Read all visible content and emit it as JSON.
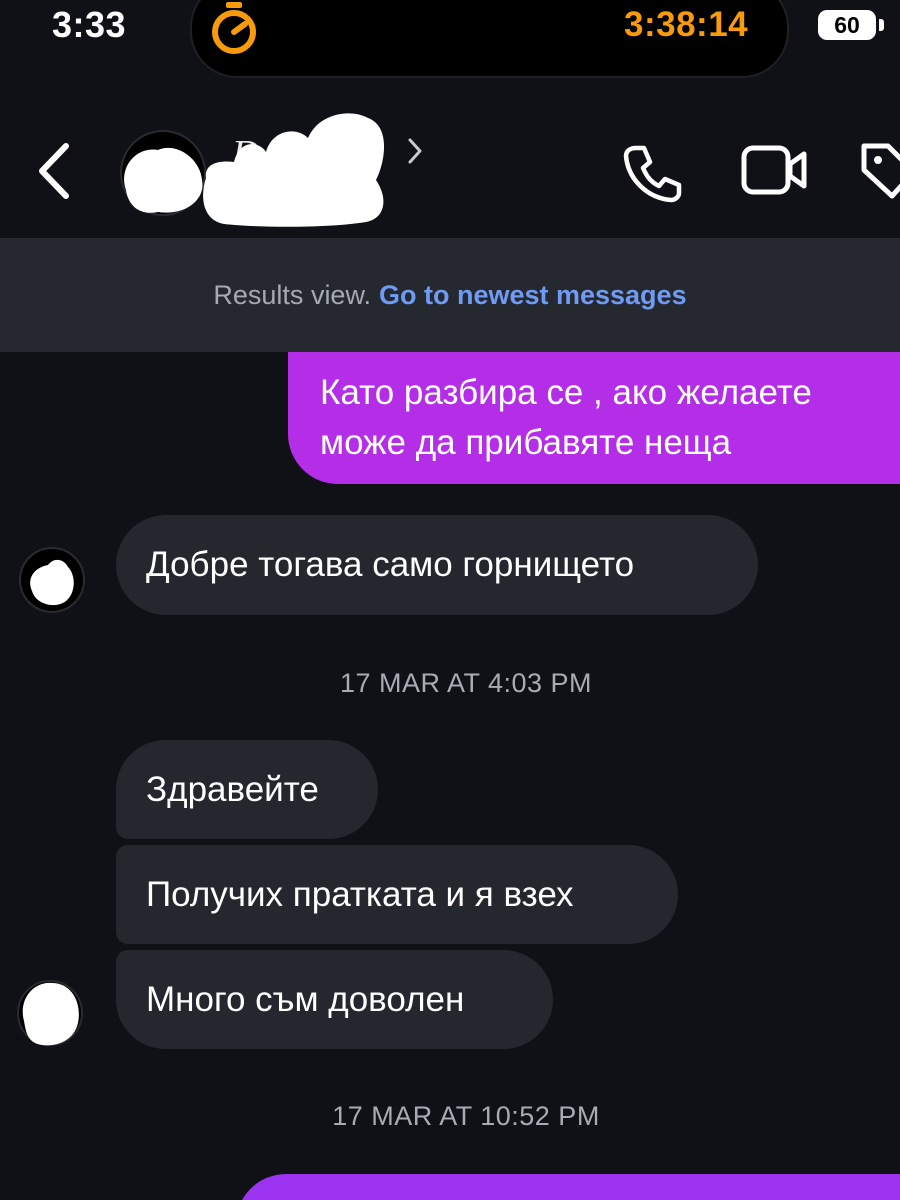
{
  "status_bar": {
    "time": "3:33",
    "timer": "3:38:14",
    "battery": "60"
  },
  "header": {
    "contact_name_visible": "D",
    "icons": [
      "back-icon",
      "chevron-right-icon",
      "phone-icon",
      "video-icon",
      "tag-icon"
    ]
  },
  "banner": {
    "text": "Results view.",
    "link": "Go to newest messages"
  },
  "messages": {
    "outgoing_1": {
      "line1": "Като разбира се , ако желаете",
      "line2": "може да прибавяте неща"
    },
    "incoming_1": "Добре тогава само горнището",
    "timestamp_1": "17 MAR AT 4:03 PM",
    "incoming_2": "Здравейте",
    "incoming_3": "Получих пратката и я взех",
    "incoming_4": "Много съм доволен",
    "timestamp_2": "17 MAR AT 10:52 PM"
  },
  "colors": {
    "background": "#101117",
    "outgoing_bubble": "#b42ee8",
    "incoming_bubble": "#25272e",
    "banner": "#25282f",
    "link": "#6f9bf5",
    "timer": "#f79b0c"
  }
}
